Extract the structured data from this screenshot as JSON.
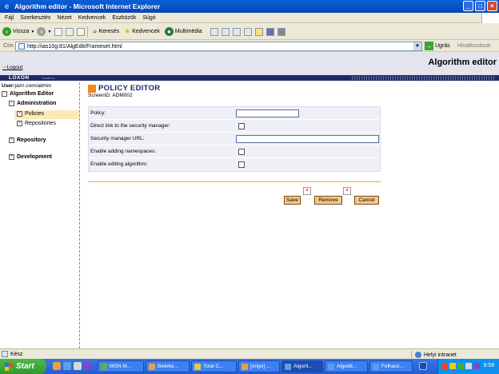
{
  "window": {
    "title": "Algorithm editor - Microsoft Internet Explorer"
  },
  "menu": [
    "Fájl",
    "Szerkesztés",
    "Nézet",
    "Kedvencek",
    "Eszközök",
    "Súgó"
  ],
  "toolbar": {
    "back": "Vissza",
    "search": "Keresés",
    "favorites": "Kedvencek",
    "media": "Multimédia"
  },
  "address": {
    "label": "Cím",
    "url": "http://ias10g:81/AlgEdit/Frameset.html",
    "go": "Ugrás",
    "links": "Hivatkozások"
  },
  "app": {
    "logout": "Logout",
    "title": "Algorithm editor",
    "logo": "LOXON",
    "logo_sub": "Solutions",
    "user_label": "User:",
    "user_value": "jazn.com/admin"
  },
  "nav": {
    "root": "Algorithm Editor",
    "administration": "Administration",
    "policies": "Policies",
    "repositories": "Repositories",
    "repository": "Repository",
    "development": "Development"
  },
  "editor": {
    "title": "POLICY EDITOR",
    "screen_id": "ScreenID: ADM002",
    "fields": {
      "policy": {
        "label": "Policy:",
        "value": ""
      },
      "direct_link": {
        "label": "Direct link to the security manager:",
        "checked": false
      },
      "sm_url": {
        "label": "Security manager URL:",
        "value": ""
      },
      "namespaces": {
        "label": "Enable adding namespaces:",
        "checked": false
      },
      "editing": {
        "label": "Enable editing algorithm:",
        "checked": false
      }
    },
    "buttons": {
      "save": "Save",
      "remove": "Remove",
      "cancel": "Cancel"
    }
  },
  "status": {
    "text": "Kész",
    "zone": "Helyi intranet"
  },
  "taskbar": {
    "start": "Start",
    "tasks": [
      "MSN M...",
      "Beérke...",
      "Total C...",
      "[origo] ...",
      "Algorit...",
      "Algedit...",
      "Felhasz..."
    ],
    "active_task_index": 4,
    "clock": "9:59"
  }
}
